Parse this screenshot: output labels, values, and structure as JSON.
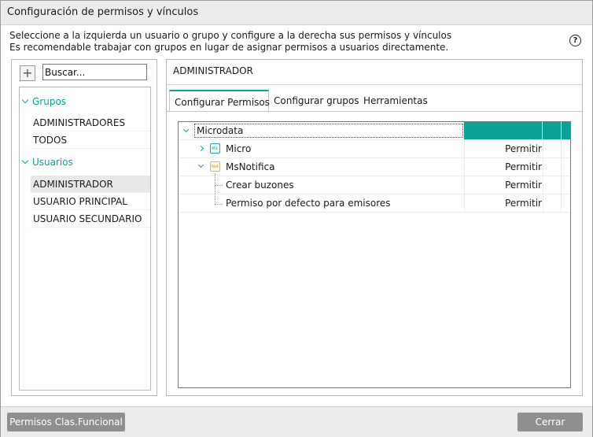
{
  "window": {
    "title": "Configuración de permisos y vínculos"
  },
  "description": {
    "line1": "Seleccione a la izquierda un usuario o grupo y configure a la derecha sus permisos y vínculos",
    "line2": "Es recomendable trabajar con grupos en lugar de asignar permisos a usuarios directamente."
  },
  "help": {
    "glyph": "?",
    "icon": "help-circle-icon"
  },
  "left_panel": {
    "add_glyph": "+",
    "search": {
      "placeholder": "Buscar..."
    },
    "groups": [
      {
        "label": "Grupos",
        "items": [
          "ADMINISTRADORES",
          "TODOS"
        ]
      },
      {
        "label": "Usuarios",
        "items": [
          "ADMINISTRADOR",
          "USUARIO PRINCIPAL",
          "USUARIO SECUNDARIO"
        ]
      }
    ],
    "selected": "ADMINISTRADOR"
  },
  "right_panel": {
    "selected_name": "ADMINISTRADOR",
    "tabs": [
      "Configurar Permisos",
      "Configurar grupos",
      "Herramientas"
    ],
    "active_tab": "Configurar Permisos",
    "grid": {
      "header": "Microdata",
      "rows": [
        {
          "name": "Micro",
          "icon_text": "Mic",
          "expanded": false,
          "permission": "Permitir"
        },
        {
          "name": "MsNotifica",
          "icon_text": "Not",
          "expanded": true,
          "permission": "Permitir"
        },
        {
          "name": "Crear buzones",
          "permission": "Permitir"
        },
        {
          "name": "Permiso por defecto para emisores",
          "permission": "Permitir"
        }
      ]
    }
  },
  "footer": {
    "left_button": "Permisos Clas.Funcional",
    "close_button": "Cerrar"
  },
  "colors": {
    "accent": "#0aa396",
    "button": "#8f8f8f",
    "chrome": "#ececec"
  }
}
